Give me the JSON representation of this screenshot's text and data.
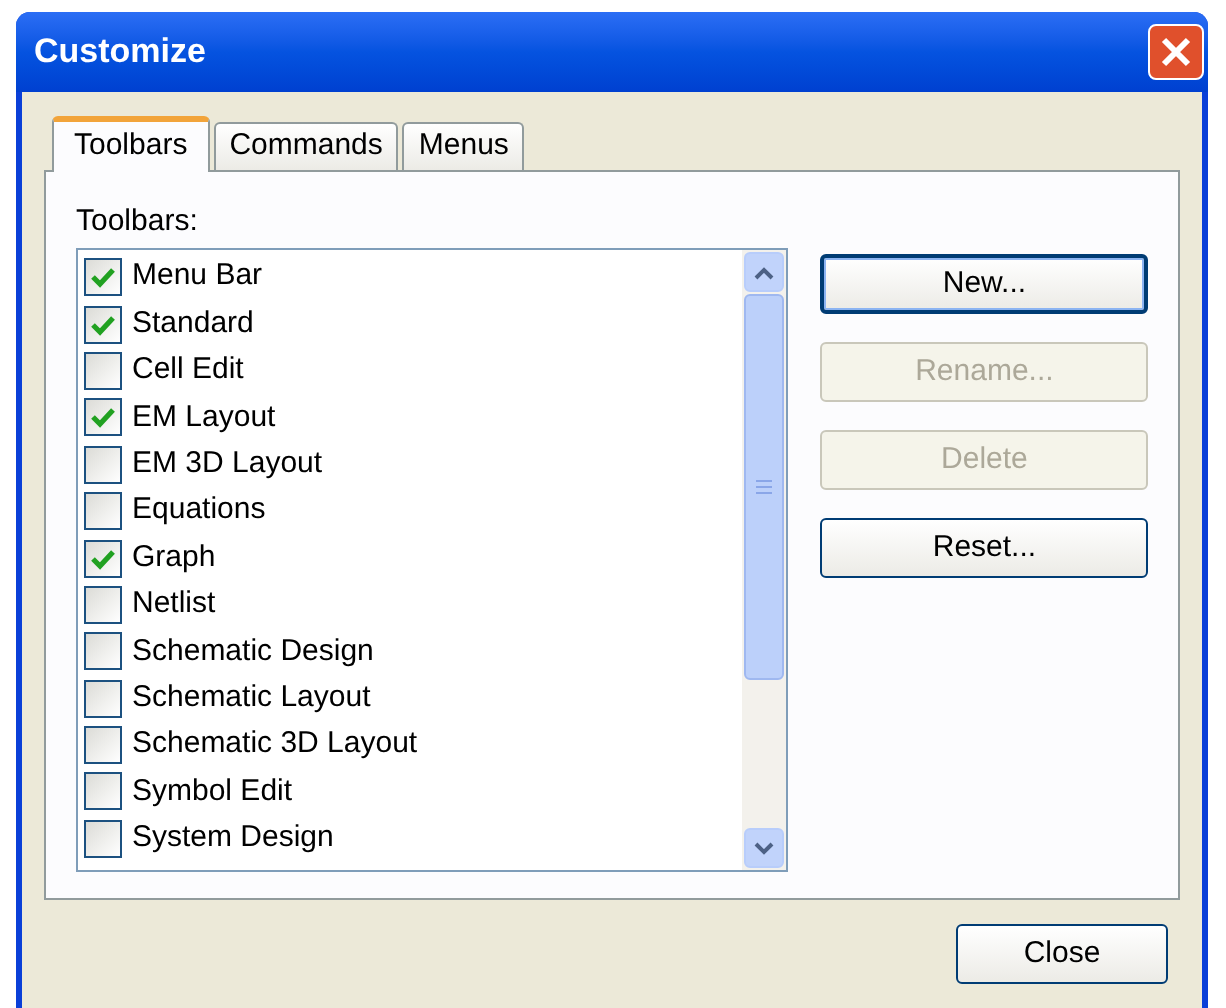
{
  "window": {
    "title": "Customize"
  },
  "tabs": [
    {
      "label": "Toolbars",
      "selected": true
    },
    {
      "label": "Commands",
      "selected": false
    },
    {
      "label": "Menus",
      "selected": false
    }
  ],
  "toolbars_label": "Toolbars:",
  "toolbars": [
    {
      "label": "Menu Bar",
      "checked": true
    },
    {
      "label": "Standard",
      "checked": true
    },
    {
      "label": "Cell Edit",
      "checked": false
    },
    {
      "label": "EM Layout",
      "checked": true
    },
    {
      "label": "EM 3D Layout",
      "checked": false
    },
    {
      "label": "Equations",
      "checked": false
    },
    {
      "label": "Graph",
      "checked": true
    },
    {
      "label": "Netlist",
      "checked": false
    },
    {
      "label": "Schematic Design",
      "checked": false
    },
    {
      "label": "Schematic Layout",
      "checked": false
    },
    {
      "label": "Schematic 3D Layout",
      "checked": false
    },
    {
      "label": "Symbol Edit",
      "checked": false
    },
    {
      "label": "System Design",
      "checked": false
    }
  ],
  "buttons": [
    {
      "label": "New...",
      "disabled": false,
      "default": true
    },
    {
      "label": "Rename...",
      "disabled": true,
      "default": false
    },
    {
      "label": "Delete",
      "disabled": true,
      "default": false
    },
    {
      "label": "Reset...",
      "disabled": false,
      "default": false
    }
  ],
  "close_button": "Close"
}
